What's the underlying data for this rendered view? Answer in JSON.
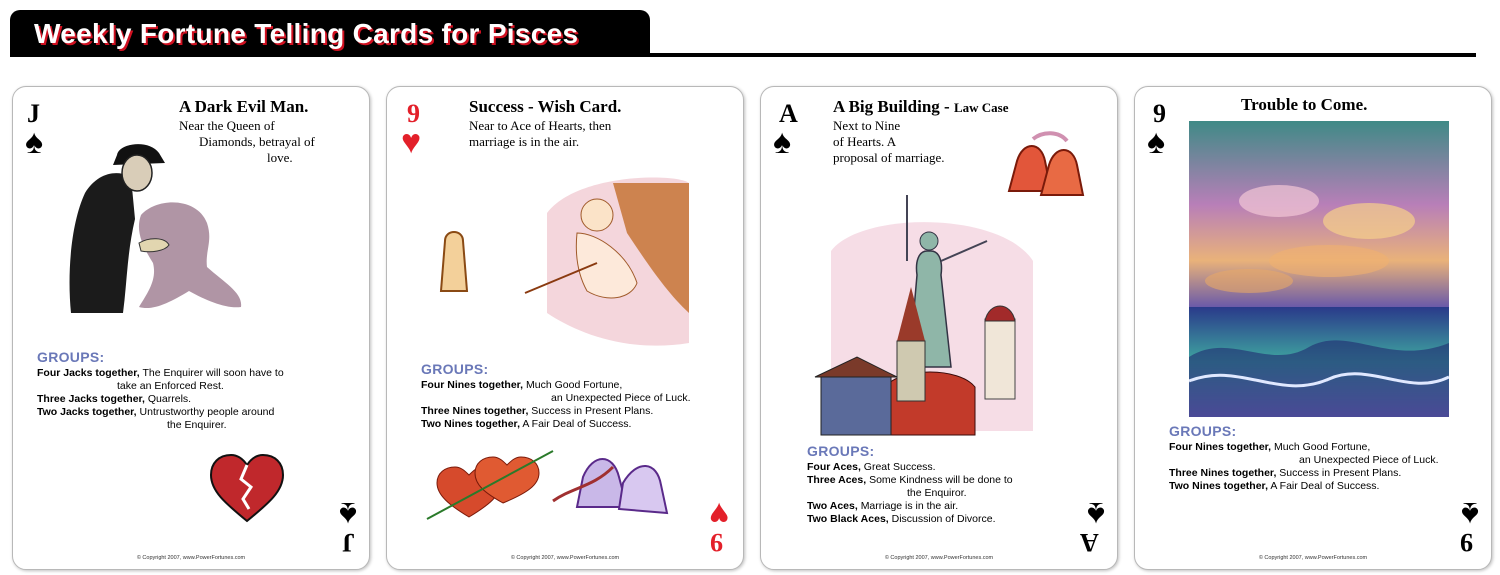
{
  "banner": {
    "title": "Weekly Fortune Telling Cards for Pisces"
  },
  "copyright": "© Copyright 2007, www.PowerFortunes.com",
  "groups_label": "GROUPS:",
  "cards": [
    {
      "rank": "J",
      "suit": "♠",
      "suit_color": "black",
      "title": "A Dark Evil Man.",
      "desc": [
        "Near the Queen  of",
        "Diamonds, betrayal of",
        "love."
      ],
      "groups": [
        {
          "lead": "Four Jacks together,",
          "text": "The Enquirer will soon have to",
          "cont": "take an Enforced Rest."
        },
        {
          "lead": "Three Jacks together,",
          "text": "Quarrels.",
          "cont": ""
        },
        {
          "lead": "Two Jacks together,",
          "text": "Untrustworthy people around",
          "cont": "the Enquirer."
        }
      ]
    },
    {
      "rank": "9",
      "suit": "♥",
      "suit_color": "red",
      "title": "Success - Wish Card.",
      "desc": [
        "Near to Ace of Hearts, then",
        "marriage is in the air."
      ],
      "groups": [
        {
          "lead": "Four Nines together,",
          "text": "Much Good Fortune,",
          "cont": "an Unexpected Piece of Luck."
        },
        {
          "lead": "Three Nines together,",
          "text": "Success in Present Plans.",
          "cont": ""
        },
        {
          "lead": "Two Nines together,",
          "text": "A Fair Deal of Success.",
          "cont": ""
        }
      ]
    },
    {
      "rank": "A",
      "suit": "♠",
      "suit_color": "black",
      "title": "A Big Building - ",
      "subtitle": "Law Case",
      "desc": [
        "Next to Nine",
        "of Hearts. A",
        "proposal of marriage."
      ],
      "groups": [
        {
          "lead": "Four Aces,",
          "text": "Great Success.",
          "cont": ""
        },
        {
          "lead": "Three Aces,",
          "text": "Some Kindness will be done to",
          "cont": "the Enquiror."
        },
        {
          "lead": "Two Aces,",
          "text": "Marriage is in the air.",
          "cont": ""
        },
        {
          "lead": "Two Black Aces,",
          "text": "Discussion of Divorce.",
          "cont": ""
        }
      ]
    },
    {
      "rank": "9",
      "suit": "♠",
      "suit_color": "black",
      "title": "Trouble to Come.",
      "groups": [
        {
          "lead": "Four Nines together,",
          "text": "Much Good Fortune,",
          "cont": "an Unexpected Piece of Luck."
        },
        {
          "lead": "Three Nines together,",
          "text": "Success in Present Plans.",
          "cont": ""
        },
        {
          "lead": "Two Nines together,",
          "text": "A Fair Deal of Success.",
          "cont": ""
        }
      ]
    }
  ]
}
